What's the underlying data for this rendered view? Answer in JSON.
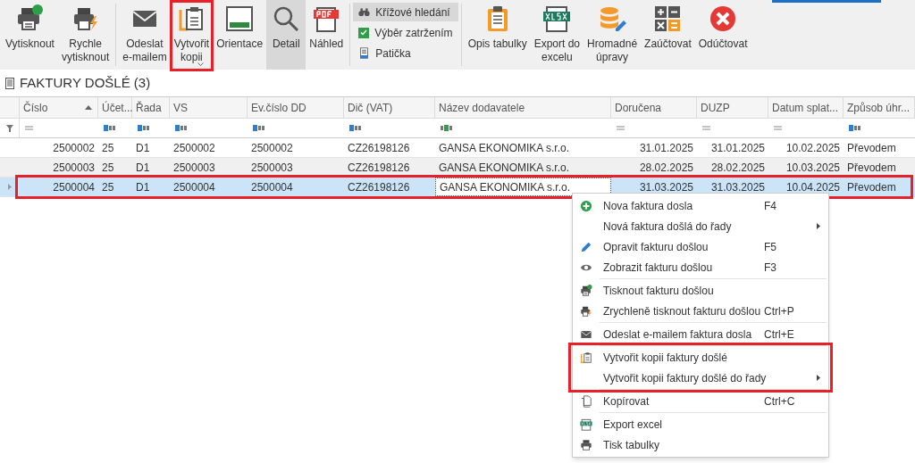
{
  "toolbar": {
    "groups": [
      {
        "kind": "large",
        "items": [
          {
            "label": "Vytisknout",
            "selected": false,
            "highlighted": false,
            "dropdown": false
          },
          {
            "label": "Rychle\nvytisknout",
            "selected": false,
            "highlighted": false,
            "dropdown": false
          }
        ]
      },
      {
        "kind": "large",
        "items": [
          {
            "label": "Odeslat\ne-mailem",
            "selected": false,
            "highlighted": false,
            "dropdown": false
          },
          {
            "label": "Vytvořit\nkopii",
            "selected": false,
            "highlighted": true,
            "dropdown": true
          },
          {
            "label": "Orientace",
            "selected": false,
            "highlighted": false,
            "dropdown": false
          },
          {
            "label": "Detail",
            "selected": true,
            "highlighted": false,
            "dropdown": false
          },
          {
            "label": "Náhled",
            "selected": false,
            "highlighted": false,
            "dropdown": false
          }
        ]
      },
      {
        "kind": "small",
        "items": [
          {
            "label": "Křížové hledání",
            "selected": true
          },
          {
            "label": "Výběr zatržením",
            "kind": "checkbox",
            "checked": true,
            "selected": false
          },
          {
            "label": "Patička",
            "selected": false
          }
        ]
      },
      {
        "kind": "large",
        "items": [
          {
            "label": "Opis tabulky",
            "selected": false,
            "highlighted": false,
            "dropdown": false
          },
          {
            "label": "Export do\nexcelu",
            "selected": false,
            "highlighted": false,
            "dropdown": false
          },
          {
            "label": "Hromadné\núpravy",
            "selected": false,
            "highlighted": false,
            "dropdown": false
          },
          {
            "label": "Zaúčtovat",
            "selected": false,
            "highlighted": false,
            "dropdown": false
          },
          {
            "label": "Odúčtovat",
            "selected": false,
            "highlighted": false,
            "dropdown": false
          }
        ]
      }
    ]
  },
  "section_title": "FAKTURY DOŠLÉ (3)",
  "table": {
    "columns": [
      {
        "label": "Číslo",
        "kind": "number",
        "sorted": true
      },
      {
        "label": "Účet...",
        "kind": "text",
        "sorted": false
      },
      {
        "label": "Řada",
        "kind": "text",
        "sorted": false
      },
      {
        "label": "VS",
        "kind": "text",
        "sorted": false
      },
      {
        "label": "Ev.číslo DD",
        "kind": "text",
        "sorted": false
      },
      {
        "label": "Dič (VAT)",
        "kind": "text",
        "sorted": false
      },
      {
        "label": "Název dodavatele",
        "kind": "contains",
        "sorted": false
      },
      {
        "label": "Doručena",
        "kind": "number",
        "sorted": false
      },
      {
        "label": "DUZP",
        "kind": "number",
        "sorted": false
      },
      {
        "label": "Datum splat...",
        "kind": "number",
        "sorted": false
      },
      {
        "label": "Způsob úhr...",
        "kind": "text",
        "sorted": false
      }
    ],
    "rows": [
      {
        "selected": false,
        "highlighted": false,
        "cells": [
          "2500002",
          "25",
          "D1",
          "2500002",
          "2500002",
          "CZ26198126",
          "GANSA EKONOMIKA s.r.o.",
          "31.01.2025",
          "31.01.2025",
          "10.02.2025",
          "Převodem"
        ]
      },
      {
        "selected": false,
        "highlighted": false,
        "cells": [
          "2500003",
          "25",
          "D1",
          "2500003",
          "2500003",
          "CZ26198126",
          "GANSA EKONOMIKA s.r.o.",
          "28.02.2025",
          "28.02.2025",
          "10.03.2025",
          "Převodem"
        ]
      },
      {
        "selected": true,
        "highlighted": true,
        "cells": [
          "2500004",
          "25",
          "D1",
          "2500004",
          "2500004",
          "CZ26198126",
          "GANSA EKONOMIKA s.r.o.",
          "31.03.2025",
          "31.03.2025",
          "10.04.2025",
          "Převodem"
        ]
      }
    ]
  },
  "context_menu": {
    "groups": [
      {
        "highlighted": false,
        "items": [
          {
            "label": "Nova faktura dosla",
            "shortcut": "F4",
            "submenu": false
          },
          {
            "label": "Nová faktura došlá do řady",
            "submenu": true
          },
          {
            "label": "Opravit fakturu došlou",
            "shortcut": "F5",
            "submenu": false
          },
          {
            "label": "Zobrazit fakturu došlou",
            "shortcut": "F3",
            "submenu": false
          }
        ]
      },
      {
        "highlighted": false,
        "items": [
          {
            "label": "Tisknout fakturu došlou",
            "submenu": false
          },
          {
            "label": "Zrychleně tisknout fakturu došlou",
            "shortcut": "Ctrl+P",
            "submenu": false
          }
        ]
      },
      {
        "highlighted": false,
        "items": [
          {
            "label": "Odeslat e-mailem faktura dosla",
            "shortcut": "Ctrl+E",
            "submenu": false
          }
        ]
      },
      {
        "highlighted": true,
        "items": [
          {
            "label": "Vytvořit kopii faktury došlé",
            "submenu": false
          },
          {
            "label": "Vytvořit kopii faktury došlé do řady",
            "submenu": true
          }
        ]
      },
      {
        "highlighted": false,
        "items": [
          {
            "label": "Kopírovat",
            "shortcut": "Ctrl+C",
            "submenu": false
          }
        ]
      },
      {
        "highlighted": false,
        "items": [
          {
            "label": "Export excel",
            "submenu": false
          },
          {
            "label": "Tisk tabulky",
            "submenu": false
          }
        ]
      }
    ]
  }
}
